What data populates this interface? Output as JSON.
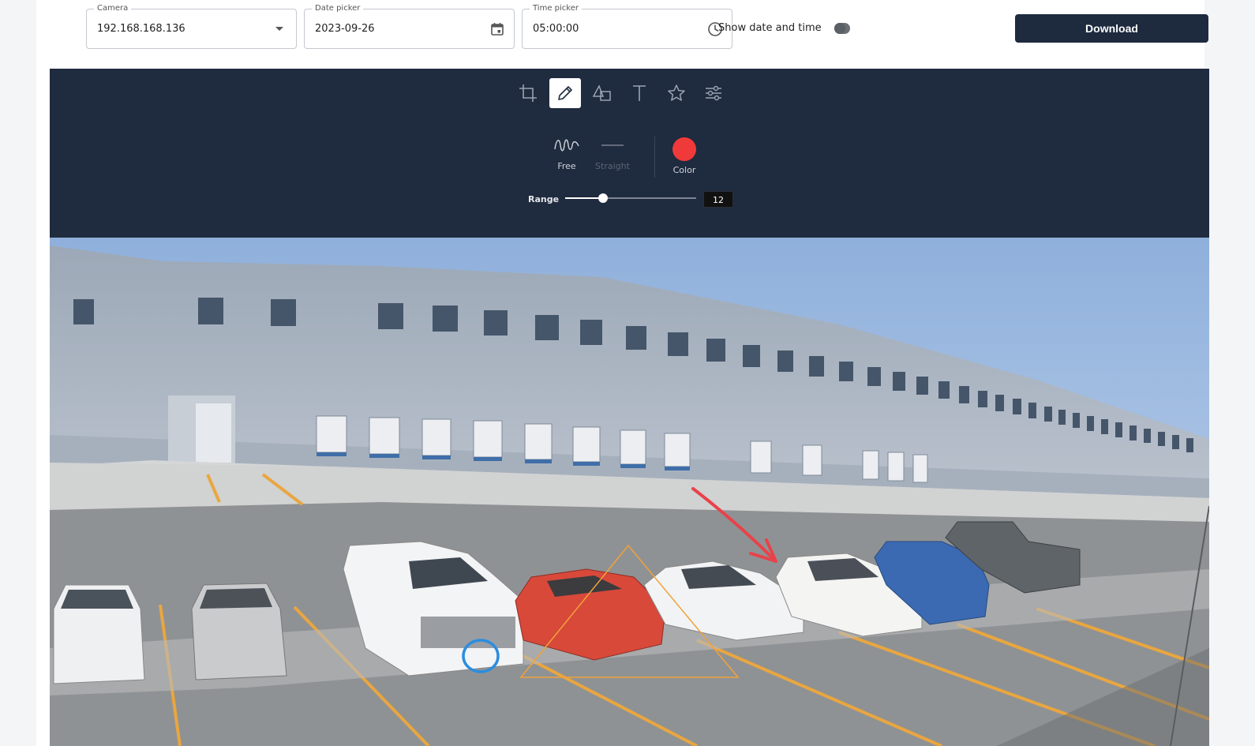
{
  "filters": {
    "camera": {
      "label": "Camera",
      "value": "192.168.168.136"
    },
    "date": {
      "label": "Date picker",
      "value": "2023-09-26"
    },
    "time": {
      "label": "Time picker",
      "value": "05:00:00"
    },
    "show_datetime": {
      "label": "Show date and time",
      "enabled": false
    },
    "download_label": "Download"
  },
  "editor": {
    "tools": [
      {
        "icon": "crop-icon",
        "active": false
      },
      {
        "icon": "pencil-icon",
        "active": true
      },
      {
        "icon": "shapes-icon",
        "active": false
      },
      {
        "icon": "text-icon",
        "active": false
      },
      {
        "icon": "star-icon",
        "active": false
      },
      {
        "icon": "adjust-icon",
        "active": false
      }
    ],
    "draw_modes": [
      {
        "label": "Free",
        "active": true
      },
      {
        "label": "Straight",
        "active": false
      }
    ],
    "color_label": "Color",
    "color": "#f03a3a",
    "range_label": "Range",
    "range_value": "12",
    "range_fraction": 0.29
  },
  "colors": {
    "accent": "#1e2a3e",
    "toolbar_bg": "#1f2b3e",
    "annotation_red": "#e8424a",
    "annotation_orange": "#f0a23a",
    "annotation_blue": "#2a8de0"
  }
}
